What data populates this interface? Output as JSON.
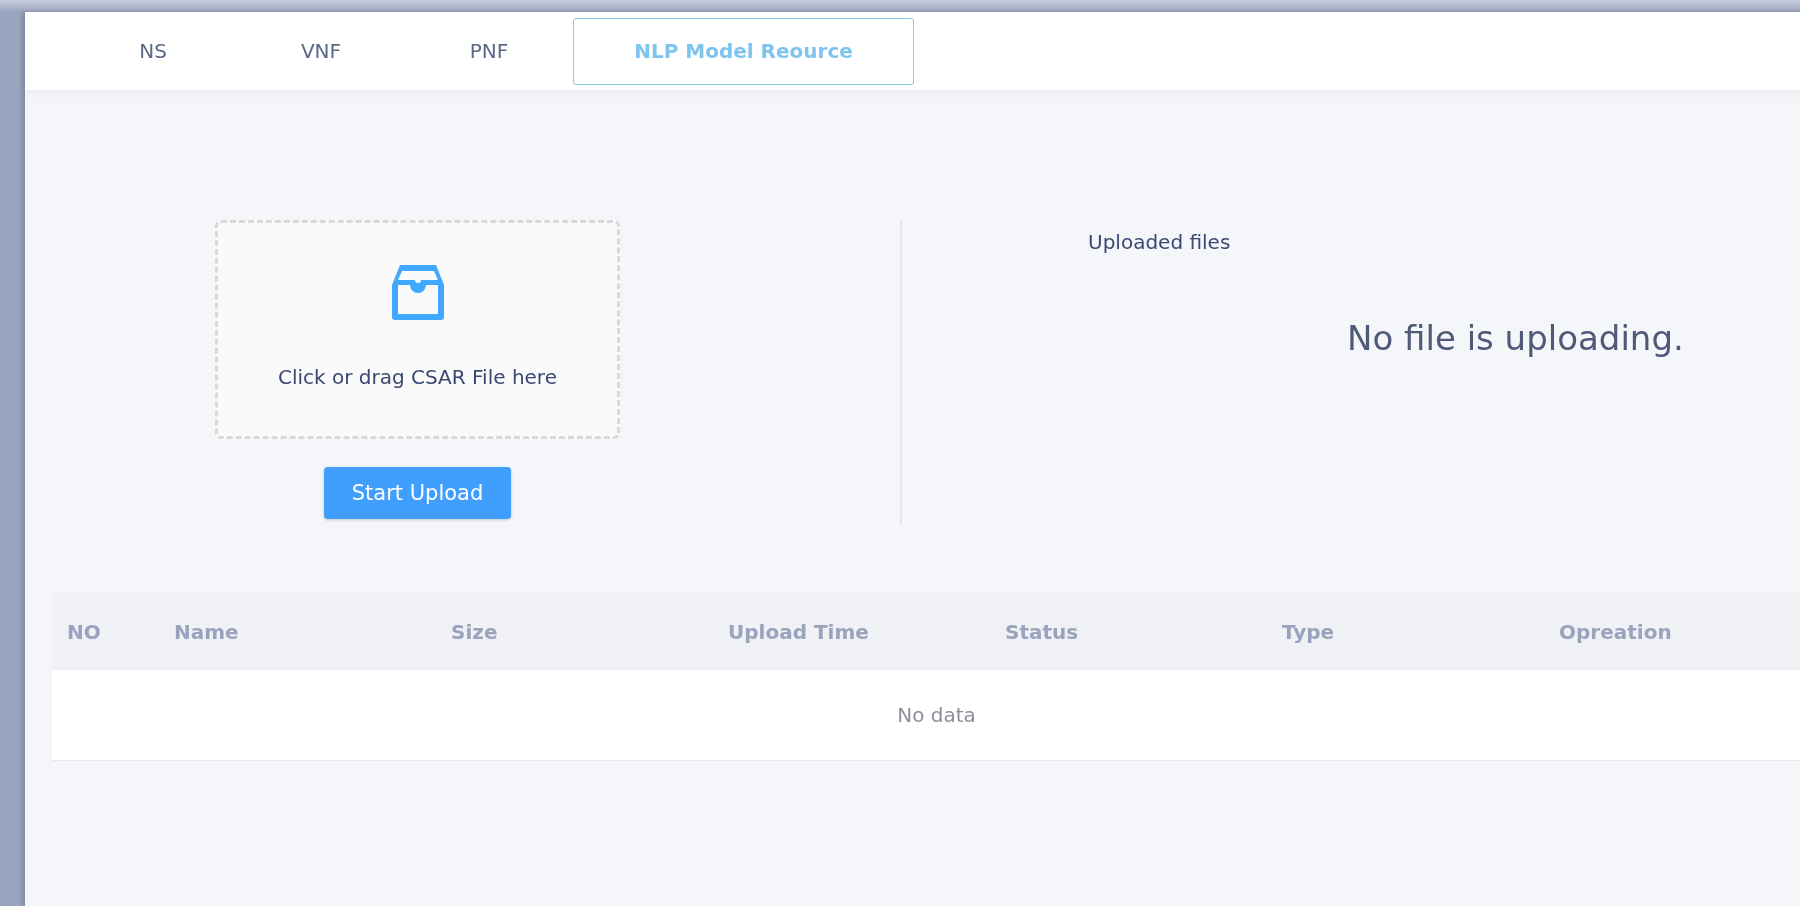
{
  "tabs": [
    {
      "label": "NS",
      "selected": false
    },
    {
      "label": "VNF",
      "selected": false
    },
    {
      "label": "PNF",
      "selected": false
    },
    {
      "label": "NLP Model Reource",
      "selected": true
    }
  ],
  "upload": {
    "hint": "Click or drag CSAR File here",
    "button": "Start Upload"
  },
  "uploaded": {
    "title": "Uploaded files",
    "empty_message": "No file is uploading."
  },
  "table": {
    "columns": [
      "NO",
      "Name",
      "Size",
      "Upload Time",
      "Status",
      "Type",
      "Opreation"
    ],
    "empty_text": "No data"
  }
}
